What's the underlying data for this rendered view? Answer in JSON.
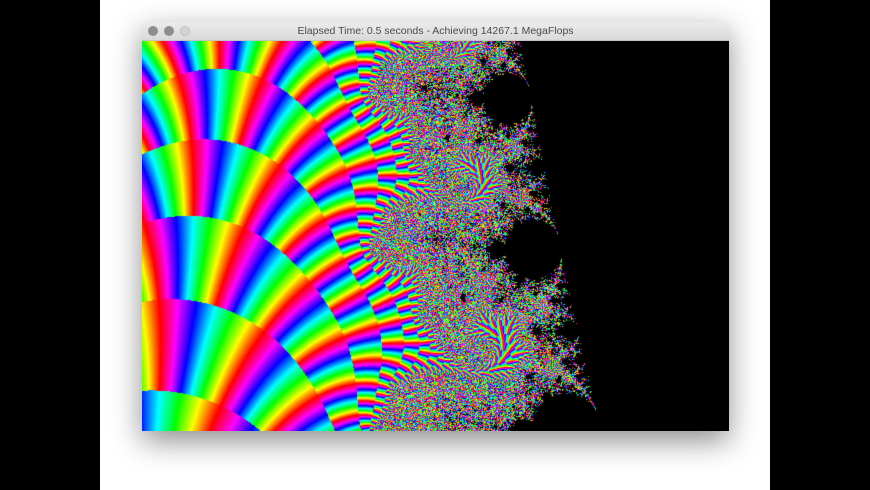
{
  "window": {
    "title": "Elapsed Time: 0.5 seconds - Achieving 14267.1 MegaFlops",
    "buttons": [
      "close",
      "minimize",
      "zoom"
    ]
  }
}
